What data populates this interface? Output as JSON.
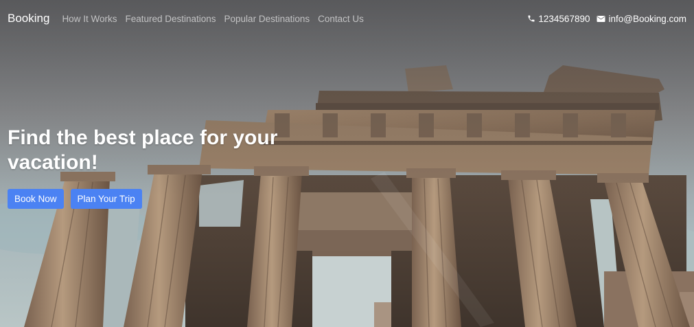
{
  "navbar": {
    "brand": "Booking",
    "links": [
      "How It Works",
      "Featured Destinations",
      "Popular Destinations",
      "Contact Us"
    ],
    "phone": "1234567890",
    "email": "info@Booking.com",
    "phone_icon": "phone-icon",
    "email_icon": "envelope-icon"
  },
  "hero": {
    "title": "Find the best place for your vacation!",
    "buttons": [
      "Book Now",
      "Plan Your Trip"
    ]
  },
  "colors": {
    "button_bg": "#4b82f3",
    "text": "#ffffff",
    "nav_link": "#b8b9bb"
  }
}
